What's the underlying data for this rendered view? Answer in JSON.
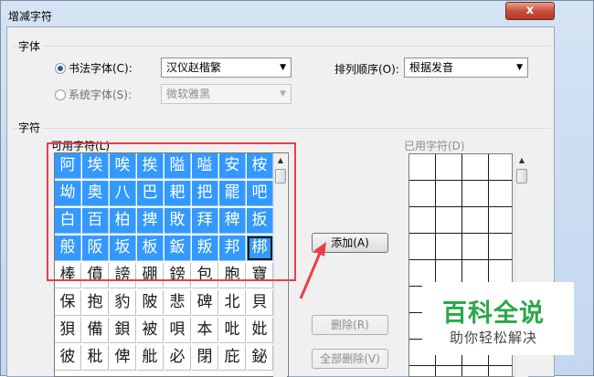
{
  "window": {
    "title": "增减字符",
    "close_label": "x"
  },
  "font_group": {
    "label": "字体",
    "calligraphy_radio": {
      "label": "书法字体(C):",
      "checked": true
    },
    "calligraphy_select": {
      "value": "汉仪赵楷繁"
    },
    "system_radio": {
      "label": "系统字体(S):",
      "checked": false
    },
    "system_select": {
      "value": "微软雅黑"
    },
    "sort_label": "排列顺序(O):",
    "sort_select": {
      "value": "根据发音"
    }
  },
  "char_group": {
    "label": "字符",
    "available_label": "可用字符(L)",
    "used_label": "已用字符(D)",
    "available_chars": [
      [
        "阿",
        "埃",
        "唉",
        "挨",
        "隘",
        "嗌",
        "安",
        "桉"
      ],
      [
        "坳",
        "奥",
        "八",
        "巴",
        "耙",
        "把",
        "罷",
        "吧"
      ],
      [
        "白",
        "百",
        "柏",
        "捭",
        "敗",
        "拜",
        "稗",
        "扳"
      ],
      [
        "般",
        "阪",
        "坂",
        "板",
        "鈑",
        "叛",
        "邦",
        "梆"
      ],
      [
        "棒",
        "僨",
        "謗",
        "硼",
        "鎊",
        "包",
        "胞",
        "寶"
      ],
      [
        "保",
        "抱",
        "豹",
        "陂",
        "悲",
        "碑",
        "北",
        "貝"
      ],
      [
        "狽",
        "備",
        "鋇",
        "被",
        "唄",
        "本",
        "吡",
        "妣"
      ],
      [
        "彼",
        "秕",
        "俾",
        "舭",
        "必",
        "閉",
        "庇",
        "鉍"
      ]
    ],
    "selected_rows": 4,
    "add_button": "添加(A)",
    "delete_button": "删除(R)",
    "delete_all_button": "全部删除(V)"
  },
  "watermark": {
    "title": "百科全说",
    "subtitle": "助你轻松解决"
  },
  "colors": {
    "selection": "#3399ff",
    "annotation": "#e8404a",
    "watermark_green": "#2aa84a"
  }
}
